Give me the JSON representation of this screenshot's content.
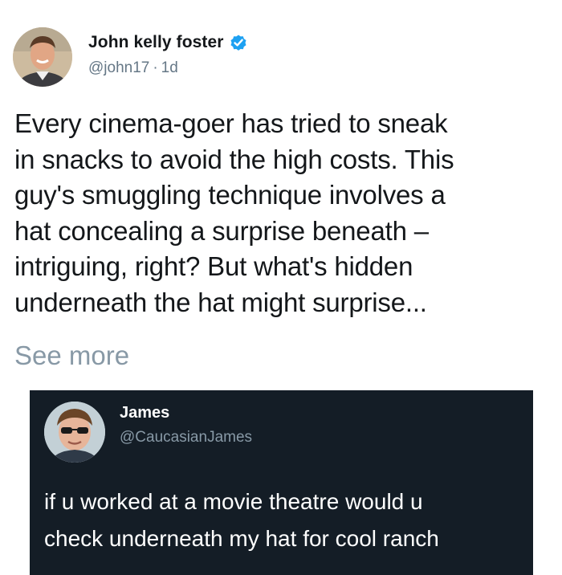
{
  "tweet": {
    "author": {
      "name": "John kelly foster",
      "handle": "@john17",
      "separator": "·",
      "timestamp": "1d",
      "verified": true
    },
    "text_lines": [
      "Every cinema-goer has tried to sneak",
      "in snacks to avoid the high costs. This",
      "guy's smuggling technique involves a",
      "hat concealing a surprise beneath –",
      "intriguing, right? But what's hidden",
      "underneath the hat might surprise..."
    ],
    "see_more_label": "See more"
  },
  "embedded_tweet": {
    "author": {
      "name": "James",
      "handle": "@CaucasianJames"
    },
    "text_lines": [
      "if u worked at a movie theatre would u",
      "check underneath my hat for cool ranch"
    ]
  },
  "icons": {
    "main_avatar": "profile-photo",
    "verified": "verified-badge-icon",
    "embed_avatar": "profile-photo"
  },
  "colors": {
    "verified_blue": "#1da1f2",
    "embed_background": "#141d26",
    "secondary_text": "#657786",
    "see_more_text": "#8899a6"
  }
}
